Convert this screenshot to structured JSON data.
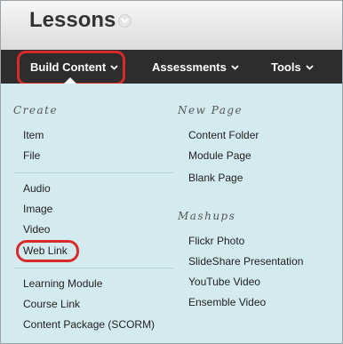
{
  "header": {
    "title": "Lessons"
  },
  "nav": {
    "build_content": "Build Content",
    "assessments": "Assessments",
    "tools": "Tools"
  },
  "menu": {
    "create_heading": "Create",
    "create_items": [
      "Item",
      "File",
      "Audio",
      "Image",
      "Video",
      "Web Link",
      "Learning Module",
      "Course Link",
      "Content Package (SCORM)"
    ],
    "new_page_heading": "New Page",
    "new_page_items": [
      "Content Folder",
      "Module Page",
      "Blank Page"
    ],
    "mashups_heading": "Mashups",
    "mashups_items": [
      "Flickr Photo",
      "SlideShare Presentation",
      "YouTube Video",
      "Ensemble Video"
    ]
  },
  "colors": {
    "highlight": "#d92a2a",
    "nav_background": "#2d2d2d",
    "menu_background": "#d3ebef"
  }
}
